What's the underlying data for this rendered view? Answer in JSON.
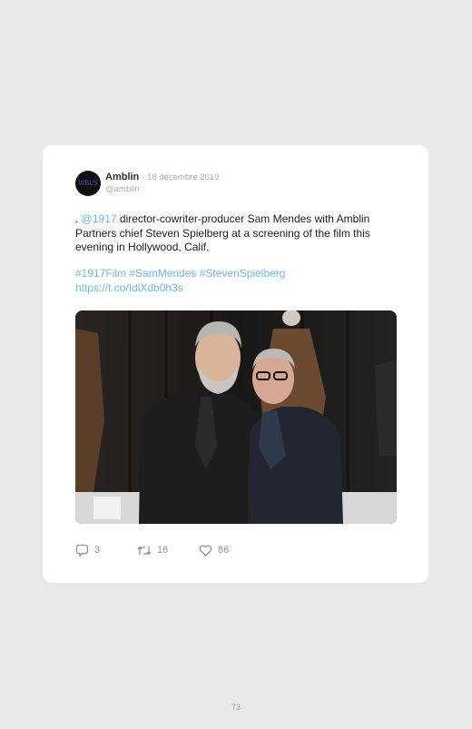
{
  "tweet": {
    "avatar_text": "WBUS",
    "author": "Amblin",
    "date": "· 18 décembre 2019",
    "handle": "@amblin",
    "text_prefix": ". ",
    "mention": "@1917",
    "text_body": " director-cowriter-producer Sam Mendes with Amblin Partners chief Steven Spielberg at a screening of the film this evening in Hollywood, Calif.",
    "hashtags": "#1917Film #SamMendes #StevenSpielberg",
    "url": "https://t.co/IdlXdb0h3s",
    "replies": "3",
    "retweets": "16",
    "likes": "86"
  },
  "footer": {
    "page_number": "73"
  },
  "icons": {
    "reply": "reply-icon",
    "retweet": "retweet-icon",
    "like": "heart-icon"
  },
  "colors": {
    "link": "#6fb8e6",
    "background": "#e9e9ea",
    "card": "#ffffff"
  }
}
